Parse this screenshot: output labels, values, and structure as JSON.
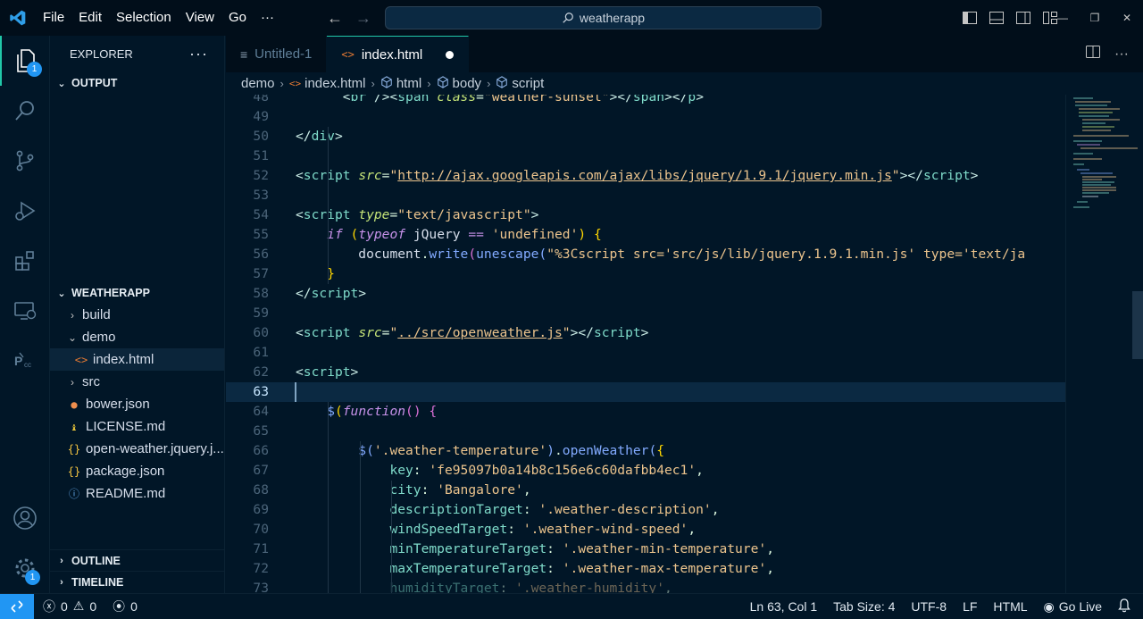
{
  "menu": [
    "File",
    "Edit",
    "Selection",
    "View",
    "Go",
    "···"
  ],
  "search": {
    "label": "weatherapp"
  },
  "activity": {
    "explorer_badge": "1",
    "settings_badge": "1"
  },
  "sidebar": {
    "title": "EXPLORER",
    "more": "···",
    "output_section": "OUTPUT",
    "workspace_section": "WEATHERAPP",
    "tree": [
      {
        "label": "build",
        "type": "folder",
        "expanded": false,
        "depth": 1
      },
      {
        "label": "demo",
        "type": "folder",
        "expanded": true,
        "depth": 1
      },
      {
        "label": "index.html",
        "type": "html",
        "depth": 2,
        "selected": true
      },
      {
        "label": "src",
        "type": "folder",
        "expanded": false,
        "depth": 1
      },
      {
        "label": "bower.json",
        "type": "bower",
        "depth": 1
      },
      {
        "label": "LICENSE.md",
        "type": "license",
        "depth": 1
      },
      {
        "label": "open-weather.jquery.j...",
        "type": "json",
        "depth": 1
      },
      {
        "label": "package.json",
        "type": "json",
        "depth": 1
      },
      {
        "label": "README.md",
        "type": "info",
        "depth": 1
      }
    ],
    "outline_section": "OUTLINE",
    "timeline_section": "TIMELINE"
  },
  "tabs": [
    {
      "label": "Untitled-1",
      "active": false
    },
    {
      "label": "index.html",
      "active": true,
      "modified": true
    }
  ],
  "breadcrumb": [
    "demo",
    "index.html",
    "html",
    "body",
    "script"
  ],
  "editor": {
    "current_line": 63,
    "lines": [
      {
        "n": "48",
        "html": "      <span class='tg'>&lt;</span><span class='t'>br</span> <span class='tg'>/&gt;&lt;</span><span class='t'>span</span> <span class='a'>class</span><span class='p'>=</span><span class='s'>\"weather-sunset\"</span><span class='tg'>&gt;&lt;/</span><span class='t'>span</span><span class='tg'>&gt;&lt;/</span><span class='t'>p</span><span class='tg'>&gt;</span>"
      },
      {
        "n": "49",
        "html": ""
      },
      {
        "n": "50",
        "html": "<span class='tg'>&lt;/</span><span class='t'>div</span><span class='tg'>&gt;</span>"
      },
      {
        "n": "51",
        "html": ""
      },
      {
        "n": "52",
        "html": "<span class='tg'>&lt;</span><span class='t'>script</span> <span class='a'>src</span><span class='p'>=</span><span class='s'>\"</span><span class='su'>http://ajax.googleapis.com/ajax/libs/jquery/1.9.1/jquery.min.js</span><span class='s'>\"</span><span class='tg'>&gt;&lt;/</span><span class='t'>script</span><span class='tg'>&gt;</span>"
      },
      {
        "n": "53",
        "html": ""
      },
      {
        "n": "54",
        "html": "<span class='tg'>&lt;</span><span class='t'>script</span> <span class='a'>type</span><span class='p'>=</span><span class='s'>\"text/javascript\"</span><span class='tg'>&gt;</span>"
      },
      {
        "n": "55",
        "html": "    <span class='k'>if</span> <span class='y'>(</span><span class='k'>typeof</span> <span class='v'>jQuery</span> <span class='k'>==</span> <span class='s'>'undefined'</span><span class='y'>)</span> <span class='y'>{</span>"
      },
      {
        "n": "56",
        "html": "        <span class='v'>document</span><span class='p'>.</span><span class='f'>write</span><span class='pk'>(</span><span class='f'>unescape</span><span class='f'>(</span><span class='s'>\"%3Cscript src='src/js/lib/jquery.1.9.1.min.js' type='text/ja</span>"
      },
      {
        "n": "57",
        "html": "    <span class='y'>}</span>"
      },
      {
        "n": "58",
        "html": "<span class='tg'>&lt;/</span><span class='t'>script</span><span class='tg'>&gt;</span>"
      },
      {
        "n": "59",
        "html": ""
      },
      {
        "n": "60",
        "html": "<span class='tg'>&lt;</span><span class='t'>script</span> <span class='a'>src</span><span class='p'>=</span><span class='s'>\"</span><span class='su'>../src/openweather.js</span><span class='s'>\"</span><span class='tg'>&gt;&lt;/</span><span class='t'>script</span><span class='tg'>&gt;</span>"
      },
      {
        "n": "61",
        "html": ""
      },
      {
        "n": "62",
        "html": "<span class='tg'>&lt;</span><span class='t'>script</span><span class='tg'>&gt;</span>"
      },
      {
        "n": "63",
        "html": ""
      },
      {
        "n": "64",
        "html": "    <span class='f'>$</span><span class='y'>(</span><span class='k'>function</span><span class='pk'>()</span> <span class='pk'>{</span>"
      },
      {
        "n": "65",
        "html": ""
      },
      {
        "n": "66",
        "html": "        <span class='f'>$</span><span class='f'>(</span><span class='s'>'.weather-temperature'</span><span class='f'>)</span><span class='p'>.</span><span class='f'>openWeather</span><span class='f'>(</span><span class='y'>{</span>"
      },
      {
        "n": "67",
        "html": "            <span class='pr'>key</span><span class='p'>:</span> <span class='s'>'fe95097b0a14b8c156e6c60dafbb4ec1'</span><span class='p'>,</span>"
      },
      {
        "n": "68",
        "html": "            <span class='pr'>city</span><span class='p'>:</span> <span class='s'>'Bangalore'</span><span class='p'>,</span>"
      },
      {
        "n": "69",
        "html": "            <span class='pr'>descriptionTarget</span><span class='p'>:</span> <span class='s'>'.weather-description'</span><span class='p'>,</span>"
      },
      {
        "n": "70",
        "html": "            <span class='pr'>windSpeedTarget</span><span class='p'>:</span> <span class='s'>'.weather-wind-speed'</span><span class='p'>,</span>"
      },
      {
        "n": "71",
        "html": "            <span class='pr'>minTemperatureTarget</span><span class='p'>:</span> <span class='s'>'.weather-min-temperature'</span><span class='p'>,</span>"
      },
      {
        "n": "72",
        "html": "            <span class='pr'>maxTemperatureTarget</span><span class='p'>:</span> <span class='s'>'.weather-max-temperature'</span><span class='p'>,</span>"
      },
      {
        "n": "73",
        "html": "<span class='fade'>            <span class='pr'>humidityTarget</span><span class='p'>:</span> <span class='s'>'.weather-humidity'</span><span class='p'>,</span></span>"
      }
    ]
  },
  "status": {
    "errors": "0",
    "warnings": "0",
    "ports": "0",
    "position": "Ln 63, Col 1",
    "tab_size": "Tab Size: 4",
    "encoding": "UTF-8",
    "eol": "LF",
    "language": "HTML",
    "go_live": "Go Live"
  },
  "colors": {
    "accent": "#21c7a8",
    "badge": "#2196f3",
    "background": "#011627"
  }
}
